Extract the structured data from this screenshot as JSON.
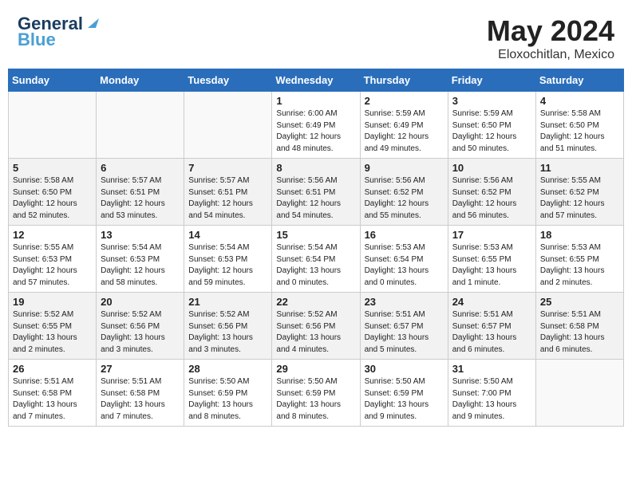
{
  "header": {
    "logo_line1": "General",
    "logo_line2": "Blue",
    "month": "May 2024",
    "location": "Eloxochitlan, Mexico"
  },
  "weekdays": [
    "Sunday",
    "Monday",
    "Tuesday",
    "Wednesday",
    "Thursday",
    "Friday",
    "Saturday"
  ],
  "weeks": [
    [
      {
        "day": "",
        "info": ""
      },
      {
        "day": "",
        "info": ""
      },
      {
        "day": "",
        "info": ""
      },
      {
        "day": "1",
        "info": "Sunrise: 6:00 AM\nSunset: 6:49 PM\nDaylight: 12 hours\nand 48 minutes."
      },
      {
        "day": "2",
        "info": "Sunrise: 5:59 AM\nSunset: 6:49 PM\nDaylight: 12 hours\nand 49 minutes."
      },
      {
        "day": "3",
        "info": "Sunrise: 5:59 AM\nSunset: 6:50 PM\nDaylight: 12 hours\nand 50 minutes."
      },
      {
        "day": "4",
        "info": "Sunrise: 5:58 AM\nSunset: 6:50 PM\nDaylight: 12 hours\nand 51 minutes."
      }
    ],
    [
      {
        "day": "5",
        "info": "Sunrise: 5:58 AM\nSunset: 6:50 PM\nDaylight: 12 hours\nand 52 minutes."
      },
      {
        "day": "6",
        "info": "Sunrise: 5:57 AM\nSunset: 6:51 PM\nDaylight: 12 hours\nand 53 minutes."
      },
      {
        "day": "7",
        "info": "Sunrise: 5:57 AM\nSunset: 6:51 PM\nDaylight: 12 hours\nand 54 minutes."
      },
      {
        "day": "8",
        "info": "Sunrise: 5:56 AM\nSunset: 6:51 PM\nDaylight: 12 hours\nand 54 minutes."
      },
      {
        "day": "9",
        "info": "Sunrise: 5:56 AM\nSunset: 6:52 PM\nDaylight: 12 hours\nand 55 minutes."
      },
      {
        "day": "10",
        "info": "Sunrise: 5:56 AM\nSunset: 6:52 PM\nDaylight: 12 hours\nand 56 minutes."
      },
      {
        "day": "11",
        "info": "Sunrise: 5:55 AM\nSunset: 6:52 PM\nDaylight: 12 hours\nand 57 minutes."
      }
    ],
    [
      {
        "day": "12",
        "info": "Sunrise: 5:55 AM\nSunset: 6:53 PM\nDaylight: 12 hours\nand 57 minutes."
      },
      {
        "day": "13",
        "info": "Sunrise: 5:54 AM\nSunset: 6:53 PM\nDaylight: 12 hours\nand 58 minutes."
      },
      {
        "day": "14",
        "info": "Sunrise: 5:54 AM\nSunset: 6:53 PM\nDaylight: 12 hours\nand 59 minutes."
      },
      {
        "day": "15",
        "info": "Sunrise: 5:54 AM\nSunset: 6:54 PM\nDaylight: 13 hours\nand 0 minutes."
      },
      {
        "day": "16",
        "info": "Sunrise: 5:53 AM\nSunset: 6:54 PM\nDaylight: 13 hours\nand 0 minutes."
      },
      {
        "day": "17",
        "info": "Sunrise: 5:53 AM\nSunset: 6:55 PM\nDaylight: 13 hours\nand 1 minute."
      },
      {
        "day": "18",
        "info": "Sunrise: 5:53 AM\nSunset: 6:55 PM\nDaylight: 13 hours\nand 2 minutes."
      }
    ],
    [
      {
        "day": "19",
        "info": "Sunrise: 5:52 AM\nSunset: 6:55 PM\nDaylight: 13 hours\nand 2 minutes."
      },
      {
        "day": "20",
        "info": "Sunrise: 5:52 AM\nSunset: 6:56 PM\nDaylight: 13 hours\nand 3 minutes."
      },
      {
        "day": "21",
        "info": "Sunrise: 5:52 AM\nSunset: 6:56 PM\nDaylight: 13 hours\nand 3 minutes."
      },
      {
        "day": "22",
        "info": "Sunrise: 5:52 AM\nSunset: 6:56 PM\nDaylight: 13 hours\nand 4 minutes."
      },
      {
        "day": "23",
        "info": "Sunrise: 5:51 AM\nSunset: 6:57 PM\nDaylight: 13 hours\nand 5 minutes."
      },
      {
        "day": "24",
        "info": "Sunrise: 5:51 AM\nSunset: 6:57 PM\nDaylight: 13 hours\nand 6 minutes."
      },
      {
        "day": "25",
        "info": "Sunrise: 5:51 AM\nSunset: 6:58 PM\nDaylight: 13 hours\nand 6 minutes."
      }
    ],
    [
      {
        "day": "26",
        "info": "Sunrise: 5:51 AM\nSunset: 6:58 PM\nDaylight: 13 hours\nand 7 minutes."
      },
      {
        "day": "27",
        "info": "Sunrise: 5:51 AM\nSunset: 6:58 PM\nDaylight: 13 hours\nand 7 minutes."
      },
      {
        "day": "28",
        "info": "Sunrise: 5:50 AM\nSunset: 6:59 PM\nDaylight: 13 hours\nand 8 minutes."
      },
      {
        "day": "29",
        "info": "Sunrise: 5:50 AM\nSunset: 6:59 PM\nDaylight: 13 hours\nand 8 minutes."
      },
      {
        "day": "30",
        "info": "Sunrise: 5:50 AM\nSunset: 6:59 PM\nDaylight: 13 hours\nand 9 minutes."
      },
      {
        "day": "31",
        "info": "Sunrise: 5:50 AM\nSunset: 7:00 PM\nDaylight: 13 hours\nand 9 minutes."
      },
      {
        "day": "",
        "info": ""
      }
    ]
  ]
}
